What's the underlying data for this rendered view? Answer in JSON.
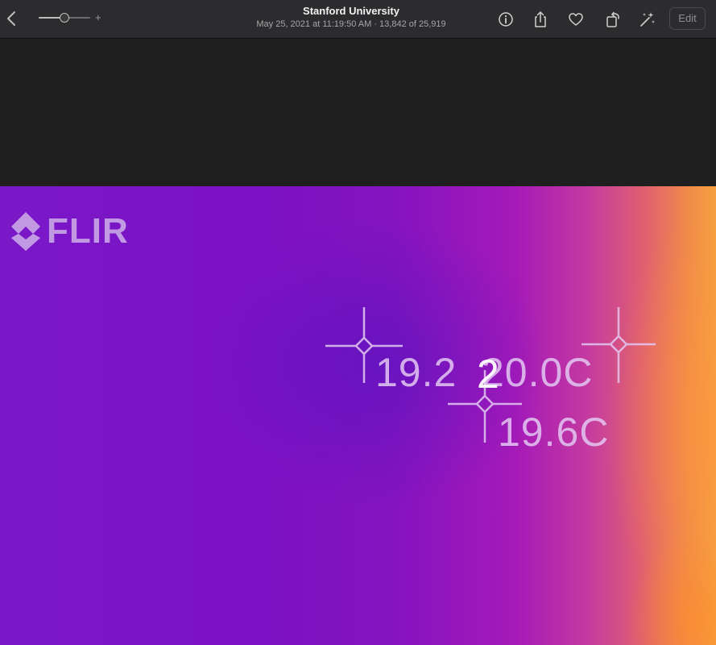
{
  "header": {
    "title": "Stanford University",
    "subtitle": "May 25, 2021 at 11:19:50 AM  ·  13,842 of 25,919",
    "zoom_plus": "+",
    "edit_label": "Edit",
    "zoom_level": 0.5
  },
  "icons": {
    "back": "chevron-left-icon",
    "info": "info-icon",
    "share": "share-icon",
    "favorite": "heart-icon",
    "rotate": "rotate-icon",
    "enhance": "magic-wand-icon"
  },
  "thermal": {
    "logo_text": "FLIR",
    "readings": {
      "spot1": "19.2",
      "spot2": "20.0C",
      "spot3": "19.6C",
      "spot2_partial": "2"
    }
  },
  "colors": {
    "toolbar": "#2c2c2e",
    "background": "#1f1f1f",
    "thermal_cold": "#7a18c8",
    "thermal_hot": "#f5a040",
    "overlay": "#e3c8f2"
  }
}
